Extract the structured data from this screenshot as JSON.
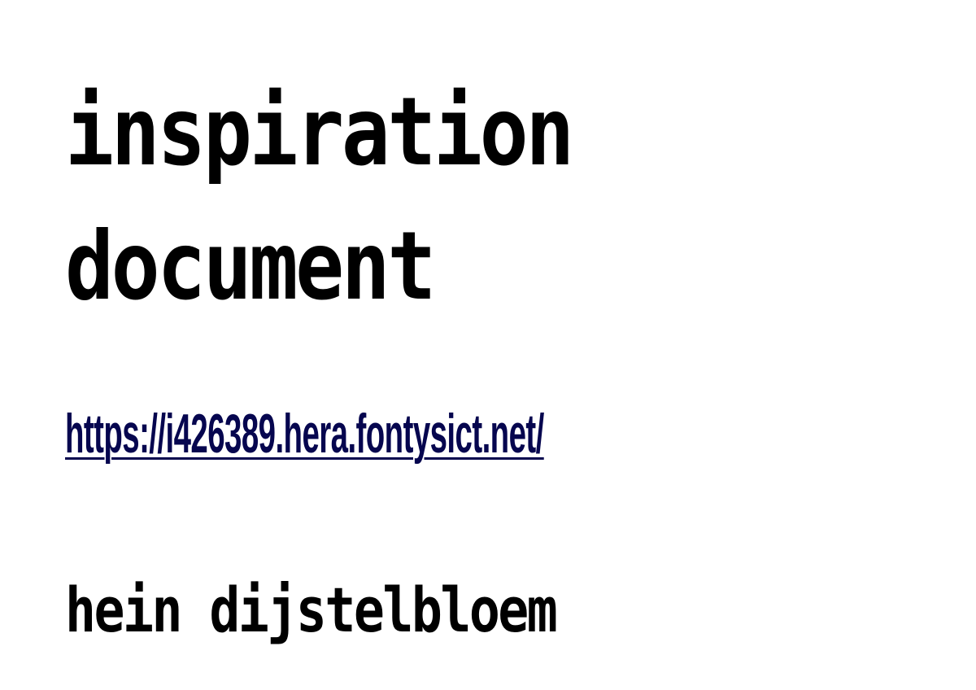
{
  "document": {
    "title_line_1": "inspiration",
    "title_line_2": "document",
    "link_text": "https://i426389.hera.fontysict.net/",
    "author": "hein dijstelbloem"
  },
  "colors": {
    "text": "#000000",
    "link": "#06064f",
    "background": "#ffffff"
  }
}
